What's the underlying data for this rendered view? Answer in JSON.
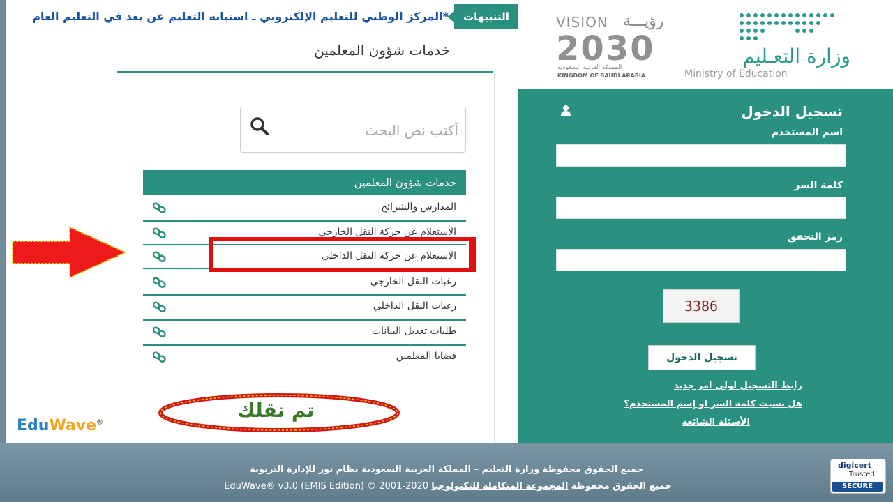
{
  "ticker": {
    "label": "التنبيهات",
    "text": "*المركز الوطني للتعليم الإلكتروني ـ استبانة التعليم عن بعد في التعليم العام"
  },
  "logos": {
    "vision_word": "VISION",
    "vision_ar": "رؤيـــة",
    "vision_year": "2030",
    "vision_kingdom_ar": "المملكة العربية السعودية",
    "vision_kingdom_en": "KINGDOM OF SAUDI ARABIA",
    "ministry_ar": "وزارة التعـليم",
    "ministry_en": "Ministry of Education"
  },
  "login": {
    "title": "تسجيل الدخول",
    "username_label": "اسم المستخدم",
    "password_label": "كلمة السر",
    "captcha_label": "رمز التحقق",
    "captcha_code": "3386",
    "button": "تسجيل الدخول",
    "link_parent": "رابط التسجيل لولي امر جديد",
    "link_forgot": "هل نسيت كلمة السر او إسم المستخدم؟",
    "link_faq": "الأسئلة الشائعة"
  },
  "services": {
    "heading": "خدمات شؤون المعلمين",
    "search_placeholder": "أكتب نص البحث",
    "list_title": "خدمات شؤون المعلمين",
    "items": [
      "المدارس والشرائح",
      "الاستعلام عن حركة النقل الخارجي",
      "الاستعلام عن حركة النقل الداخلي",
      "رغبات النقل الخارجي",
      "رغبات النقل الداخلي",
      "طلبات تعديل البيانات",
      "قضايا المعلمين"
    ],
    "annotation": "تم نقلك"
  },
  "brand": {
    "edu": "Edu",
    "wave": "Wave",
    "reg": "®"
  },
  "footer": {
    "line1": "جميع الحقوق محفوظة وزارة التعليم – المملكة العربية السعودية نظام نور للإدارة التربوية",
    "line2_prefix": "جميع الحقوق محفوظة",
    "line2_company": "المجموعة المتكاملة للتكنولوجيا",
    "line2_suffix": "EduWave® v3.0 (EMIS Edition) © 2001-2020"
  },
  "badge": {
    "brand": "digicert",
    "trusted": "Trusted",
    "secure": "SECURE"
  },
  "colors": {
    "teal": "#2a9080",
    "highlight_red": "#e01010",
    "ticker_blue": "#1c55a5"
  }
}
